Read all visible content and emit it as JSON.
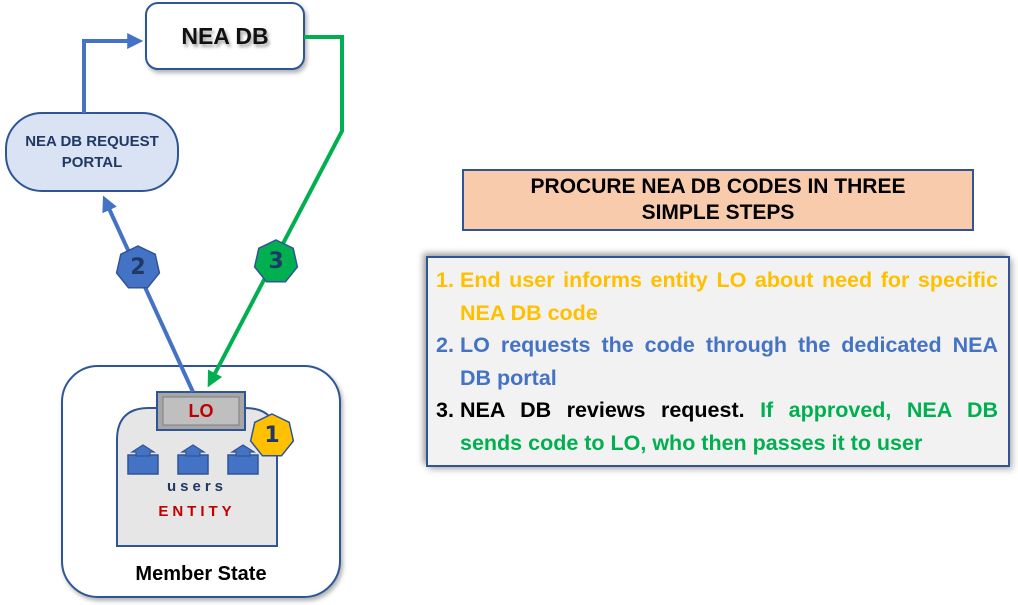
{
  "diagram": {
    "nea_db": {
      "label": "NEA DB"
    },
    "portal": {
      "line1": "NEA DB REQUEST",
      "line2": "PORTAL"
    },
    "member_state": {
      "label": "Member State"
    },
    "entity": {
      "lo_label": "LO",
      "users_label": "users",
      "entity_label": "ENTITY",
      "user_icon_count": 3
    },
    "badges": [
      {
        "number": "1",
        "color": "#ffc000"
      },
      {
        "number": "2",
        "color": "#4472c4"
      },
      {
        "number": "3",
        "color": "#00b050"
      }
    ],
    "arrows": [
      {
        "from": "LO",
        "to": "NEA DB REQUEST PORTAL",
        "step": "2",
        "color": "#4472c4"
      },
      {
        "from": "NEA DB REQUEST PORTAL",
        "to": "NEA DB",
        "color": "#4472c4"
      },
      {
        "from": "NEA DB",
        "to": "LO",
        "step": "3",
        "color": "#00b050"
      }
    ]
  },
  "heading": {
    "line1": "PROCURE NEA DB CODES IN THREE",
    "line2": "SIMPLE STEPS",
    "background": "#f8cbad"
  },
  "steps": [
    {
      "number": "1.",
      "parts": [
        {
          "text": "End user informs entity LO about need for specific NEA DB code",
          "color": "#ffc000"
        }
      ]
    },
    {
      "number": "2.",
      "parts": [
        {
          "text": "LO requests the code through the dedicated NEA DB portal",
          "color": "#4472c4"
        }
      ]
    },
    {
      "number": "3.",
      "parts": [
        {
          "text": "NEA DB reviews request. ",
          "color": "#000000"
        },
        {
          "text": "If approved, NEA DB sends code to LO, who then passes it to user",
          "color": "#00b050"
        }
      ]
    }
  ]
}
